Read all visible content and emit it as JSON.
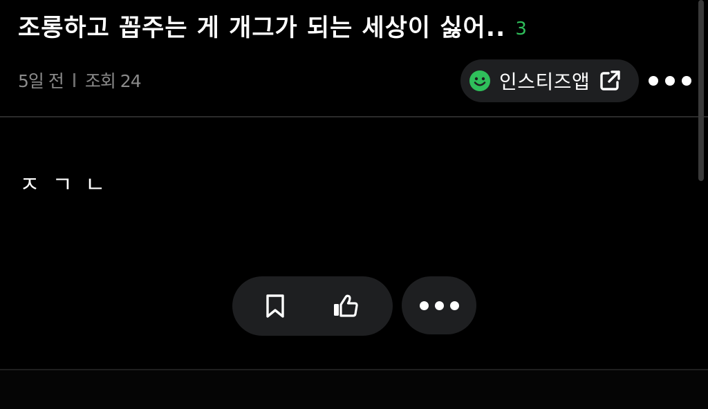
{
  "post": {
    "title": "조롱하고 꼽주는 게 개그가 되는 세상이 싫어..",
    "comment_count": "3",
    "time_ago": "5일 전",
    "views": "조회 24",
    "body": "ㅈㄱㄴ"
  },
  "app_link": {
    "label": "인스티즈앱",
    "icon_left": "smile-icon",
    "icon_right": "external-link-icon"
  },
  "actions": {
    "bookmark_icon": "bookmark-icon",
    "like_icon": "thumbs-up-icon",
    "more_icon": "more-dots-icon"
  },
  "colors": {
    "background": "#000000",
    "pill": "#1e1f21",
    "accent_green": "#2fbf5b",
    "meta_text": "#8a8a8a"
  }
}
